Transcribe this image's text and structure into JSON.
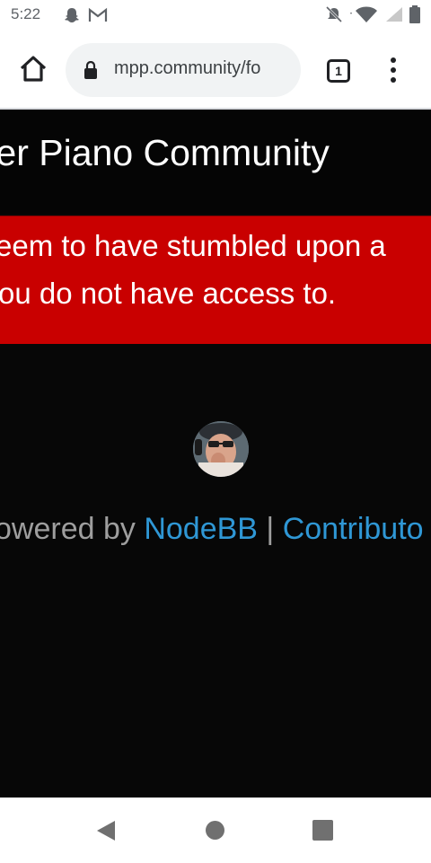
{
  "status_bar": {
    "time": "5:22",
    "left_icons": [
      "snapchat-icon",
      "gmail-icon"
    ],
    "right_icons": [
      "notifications-off-icon",
      "wifi-icon",
      "signal-icon",
      "battery-icon"
    ]
  },
  "browser": {
    "url": "mpp.community/fo",
    "tab_count": "1",
    "icons": [
      "home-icon",
      "lock-icon",
      "more-vert-icon"
    ]
  },
  "page": {
    "header_title": "layer Piano Community",
    "alert_line_1": "eem to have stumbled upon a",
    "alert_line_2": "ou do not have access to.",
    "footer_powered": "owered by ",
    "footer_nodebb": "NodeBB",
    "footer_separator": " | ",
    "footer_contributors": "Contributo"
  },
  "colors": {
    "page_background": "#070707",
    "alert_background": "#c90000",
    "link_color": "#2f97d5",
    "footer_text": "#9e9e9e"
  },
  "nav_bar": {
    "icons": [
      "back-icon",
      "home-circle-icon",
      "recents-icon"
    ]
  }
}
